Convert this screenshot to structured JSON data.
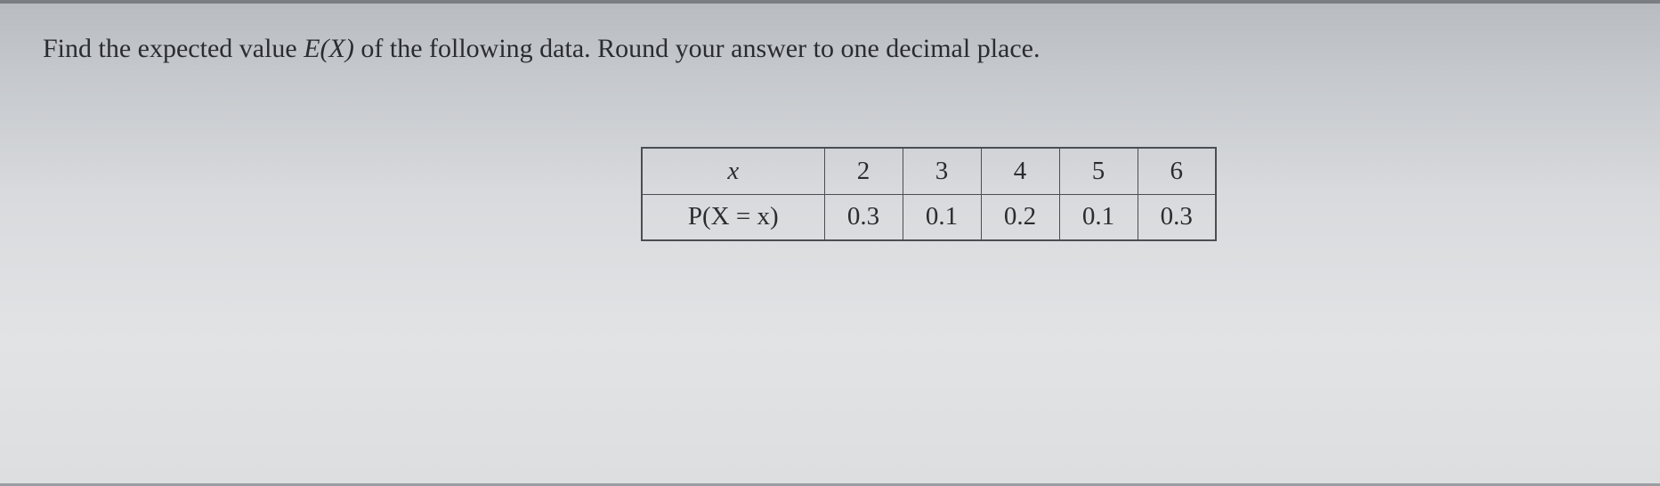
{
  "question": {
    "prefix": "Find the expected value ",
    "expression": "E(X)",
    "suffix": " of the following data. Round your answer to one decimal place."
  },
  "chart_data": {
    "type": "table",
    "row_labels": [
      "x",
      "P(X = x)"
    ],
    "columns": [
      "2",
      "3",
      "4",
      "5",
      "6"
    ],
    "rows": {
      "x": [
        "2",
        "3",
        "4",
        "5",
        "6"
      ],
      "p": [
        "0.3",
        "0.1",
        "0.2",
        "0.1",
        "0.3"
      ]
    }
  }
}
